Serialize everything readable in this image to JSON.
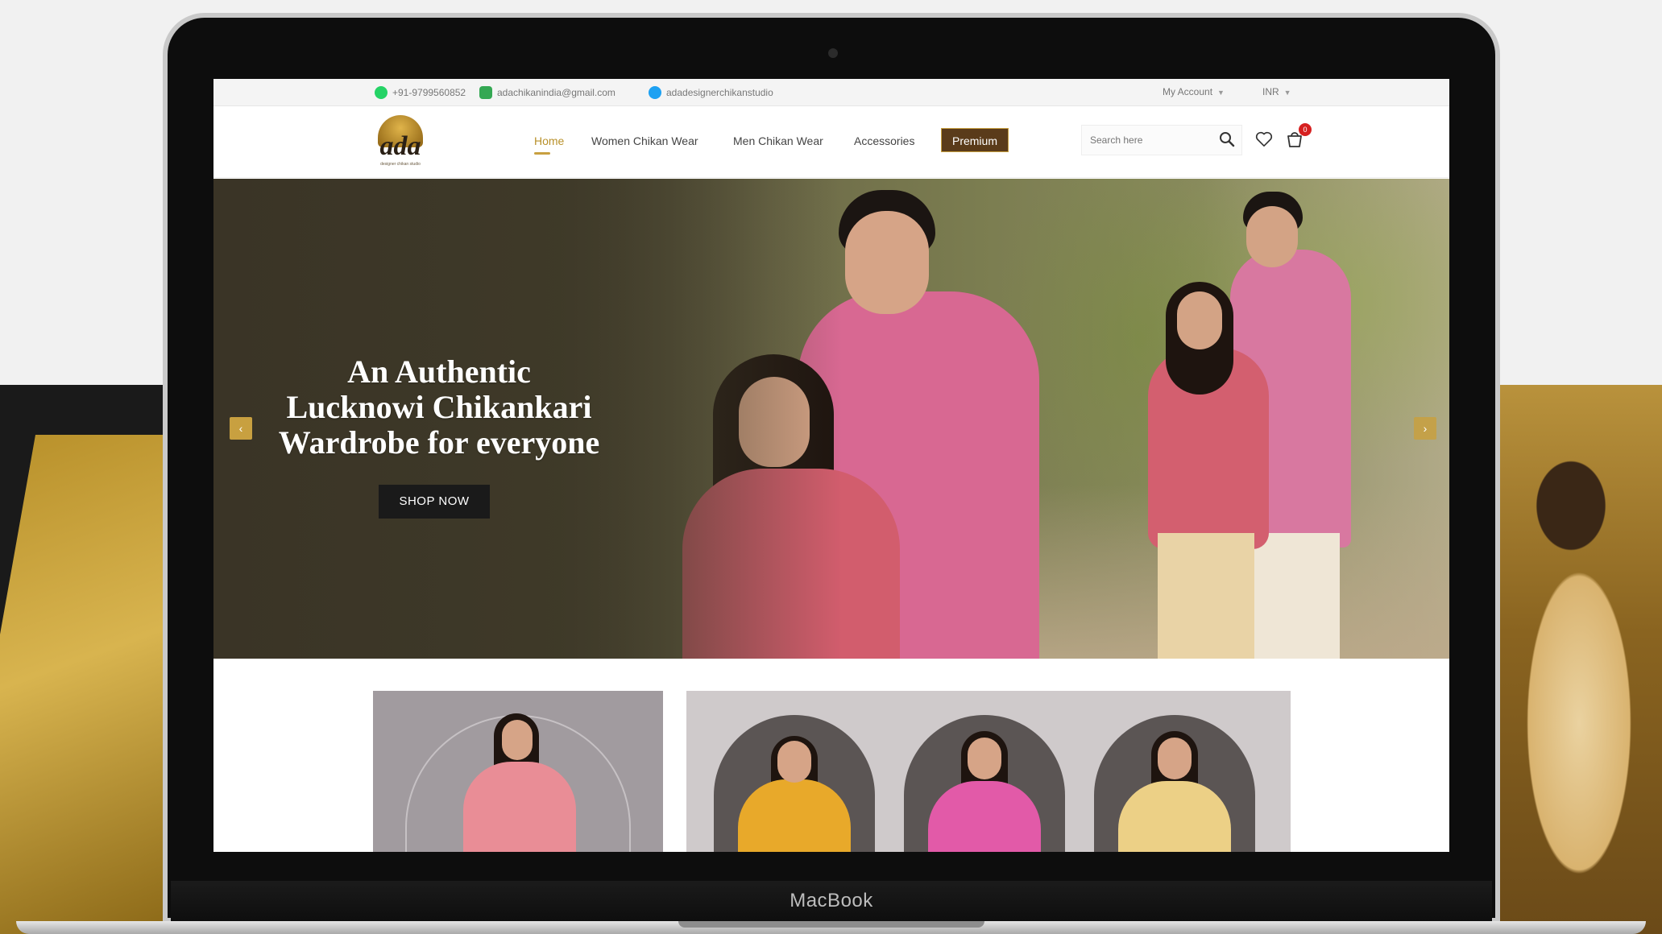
{
  "topbar": {
    "phone": "+91-9799560852",
    "email": "adachikanindia@gmail.com",
    "skype": "adadesignerchikanstudio",
    "account_label": "My Account",
    "currency_label": "INR"
  },
  "header": {
    "logo_text": "ada",
    "logo_tagline": "designer chikan studio",
    "nav": [
      {
        "label": "Home",
        "active": true
      },
      {
        "label": "Women Chikan Wear",
        "active": false
      },
      {
        "label": "Men Chikan Wear",
        "active": false
      },
      {
        "label": "Accessories",
        "active": false
      },
      {
        "label": "Premium",
        "active": false
      }
    ],
    "search_placeholder": "Search here",
    "cart_count": "0"
  },
  "hero": {
    "title": "An Authentic\nLucknowi Chikankari\nWardrobe for everyone",
    "cta_label": "SHOP NOW",
    "prev_arrow": "‹",
    "next_arrow": "›"
  },
  "device": {
    "label": "MacBook"
  },
  "colors": {
    "accent_gold": "#c8a040",
    "premium_brown": "#5a3b1a",
    "badge_red": "#d62020"
  },
  "icons": [
    "whatsapp-icon",
    "mail-icon",
    "skype-icon",
    "search-icon",
    "heart-icon",
    "cart-icon",
    "arrow-left-icon",
    "arrow-right-icon"
  ]
}
